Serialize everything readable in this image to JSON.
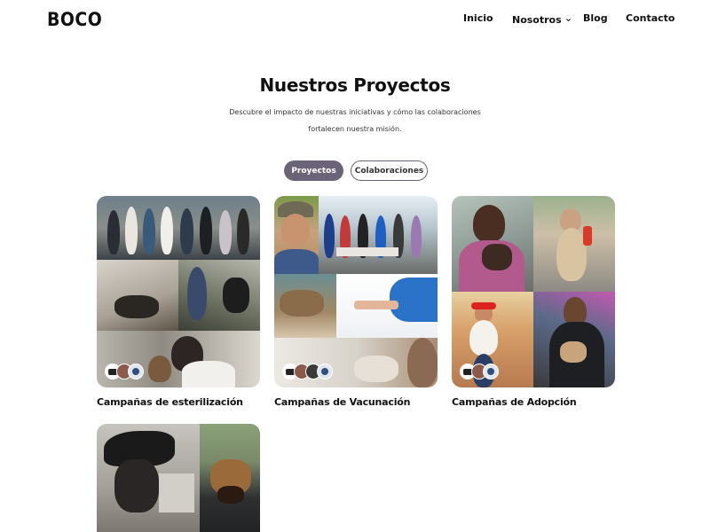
{
  "nav": {
    "logo": "BOCO",
    "items": [
      {
        "label": "Inicio"
      },
      {
        "label": "Nosotros"
      },
      {
        "label": "Blog"
      },
      {
        "label": "Contacto"
      }
    ]
  },
  "hero": {
    "title": "Nuestros Proyectos",
    "subtitle": "Descubre el impacto de nuestras iniciativas y cómo las colaboraciones fortalecen nuestra misión."
  },
  "tabs": [
    {
      "label": "Proyectos",
      "active": true
    },
    {
      "label": "Colaboraciones",
      "active": false
    }
  ],
  "projects": [
    {
      "title": "Campañas de esterilización"
    },
    {
      "title": "Campañas de Vacunación"
    },
    {
      "title": "Campañas de Adopción"
    },
    {
      "title": ""
    }
  ],
  "colors": {
    "accent": "#6b6478",
    "text": "#111111",
    "background": "#ffffff"
  },
  "icons": [
    "chevron-down-icon",
    "partner-avatar-icon"
  ]
}
